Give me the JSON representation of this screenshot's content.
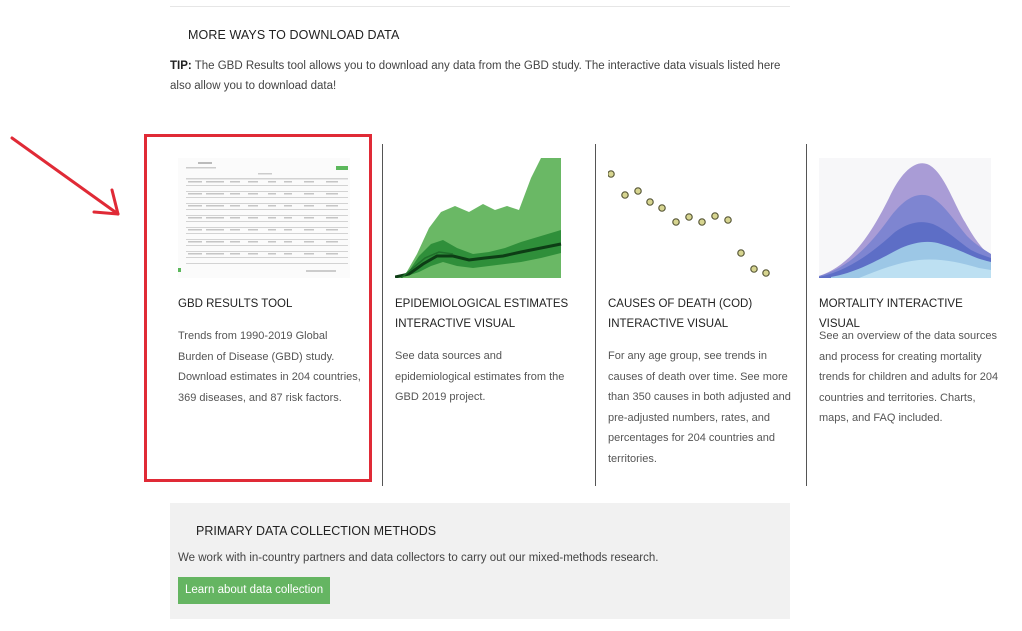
{
  "section": {
    "heading": "MORE WAYS TO DOWNLOAD DATA",
    "tip_label": "TIP:",
    "tip_text": " The GBD Results tool allows you to download any data from the GBD study. The interactive data visuals listed here also allow you to download data!"
  },
  "cards": [
    {
      "title": "GBD RESULTS TOOL",
      "description": "Trends from 1990-2019 Global Burden of Disease (GBD) study. Download estimates in 204 countries, 369 diseases, and 87 risk factors."
    },
    {
      "title": "EPIDEMIOLOGICAL ESTIMATES INTERACTIVE VISUAL",
      "description": "See data sources and epidemiological estimates from the GBD 2019 project."
    },
    {
      "title": "CAUSES OF DEATH (COD) INTERACTIVE VISUAL",
      "description": "For any age group, see trends in causes of death over time. See more than 350 causes in both adjusted and pre-adjusted numbers, rates, and percentages for 204 countries and territories."
    },
    {
      "title": "MORTALITY INTERACTIVE VISUAL",
      "description": "See an overview of the data sources and process for creating mortality trends for children and adults for 204 countries and territories. Charts, maps, and FAQ included."
    }
  ],
  "primary": {
    "heading": "PRIMARY DATA COLLECTION METHODS",
    "text": "We work with in-country partners and data collectors to carry out our mixed-methods research.",
    "button_label": "Learn about data collection"
  },
  "colors": {
    "highlight": "#e02a36",
    "accent_green": "#65b562",
    "panel_bg": "#f1f1f1"
  },
  "icons": {
    "annotation": "red-arrow"
  }
}
